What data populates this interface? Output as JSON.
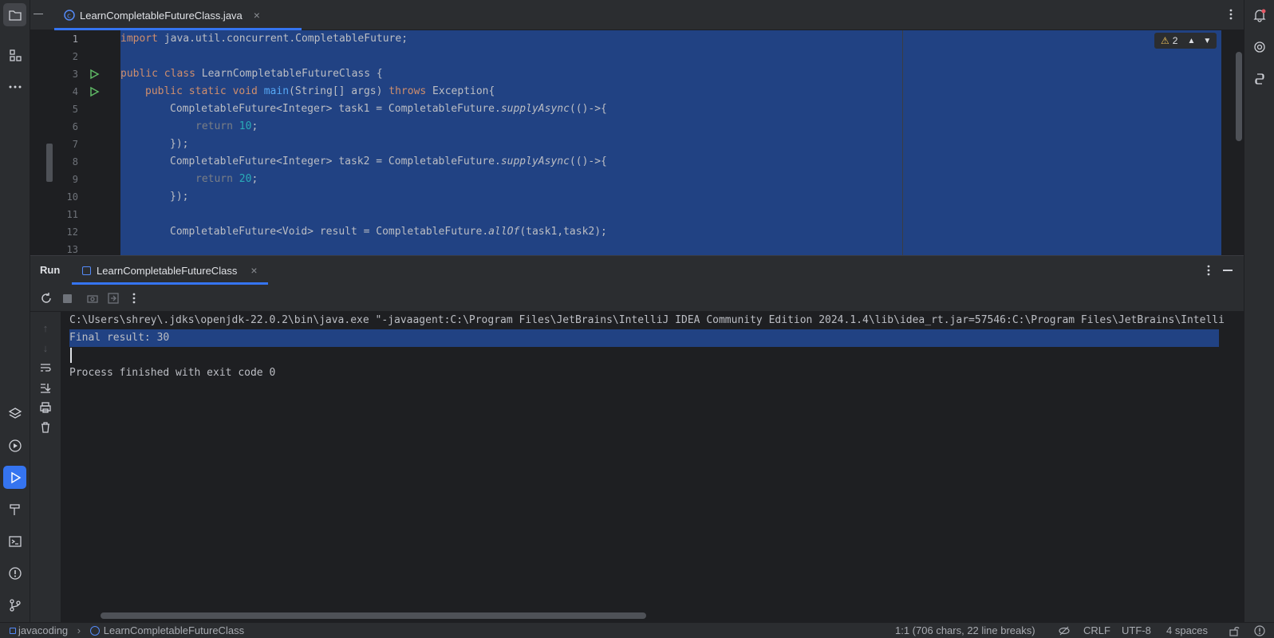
{
  "editor": {
    "tab_label": "LearnCompletableFutureClass.java",
    "warnings_count": "2",
    "line_numbers": [
      "1",
      "2",
      "3",
      "4",
      "5",
      "6",
      "7",
      "8",
      "9",
      "10",
      "11",
      "12",
      "13"
    ],
    "code": {
      "l1_kw": "import",
      "l1_rest": " java.util.concurrent.CompletableFuture;",
      "l3_kw": "public class",
      "l3_rest": " LearnCompletableFutureClass {",
      "l4_kw": "public static void",
      "l4_fn": "main",
      "l4_mid": "(String[] args) ",
      "l4_kw2": "throws",
      "l4_rest": " Exception{",
      "l5_a": "CompletableFuture<Integer> task1 = CompletableFuture.",
      "l5_it": "supplyAsync",
      "l5_b": "(()->{",
      "l6_kw": "return",
      "l6_num": "10",
      "l6_end": ";",
      "l7": "});",
      "l8_a": "CompletableFuture<Integer> task2 = CompletableFuture.",
      "l8_it": "supplyAsync",
      "l8_b": "(()->{",
      "l9_kw": "return",
      "l9_num": "20",
      "l9_end": ";",
      "l10": "});",
      "l12_a": "CompletableFuture<Void> result = CompletableFuture.",
      "l12_it": "allOf",
      "l12_b": "(task1,task2);"
    }
  },
  "run": {
    "title": "Run",
    "tab_label": "LearnCompletableFutureClass",
    "console": [
      "C:\\Users\\shrey\\.jdks\\openjdk-22.0.2\\bin\\java.exe \"-javaagent:C:\\Program Files\\JetBrains\\IntelliJ IDEA Community Edition 2024.1.4\\lib\\idea_rt.jar=57546:C:\\Program Files\\JetBrains\\Intelli",
      "Final result: 30",
      "",
      "Process finished with exit code 0"
    ]
  },
  "statusbar": {
    "project": "javacoding",
    "file": "LearnCompletableFutureClass",
    "position": "1:1 (706 chars, 22 line breaks)",
    "line_separator": "CRLF",
    "encoding": "UTF-8",
    "indent": "4 spaces"
  },
  "icons": {
    "left_strip": [
      "folder-icon",
      "structure-icon",
      "more-icon",
      "layers-icon",
      "services-icon",
      "run-icon",
      "build-icon",
      "terminal-icon",
      "problems-icon",
      "git-icon"
    ],
    "right_strip": [
      "notifications-icon",
      "ai-assistant-icon",
      "python-icon"
    ]
  },
  "colors": {
    "accent": "#3574f0",
    "selection": "#214283",
    "background": "#1e1f22",
    "panel": "#2b2d30",
    "keyword": "#cf8e6d",
    "function": "#56a8f5",
    "number": "#2aacb8"
  }
}
